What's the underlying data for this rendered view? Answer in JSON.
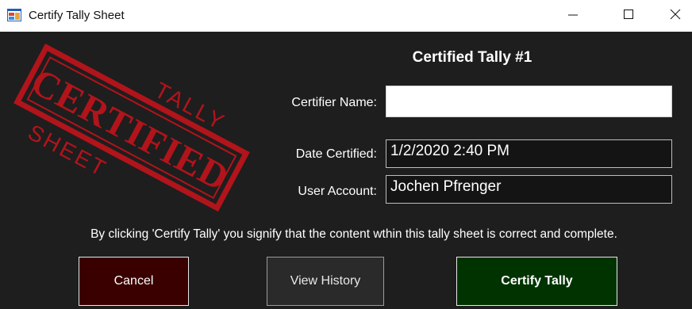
{
  "window": {
    "title": "Certify Tally Sheet",
    "controls": [
      "minimize",
      "maximize",
      "close"
    ]
  },
  "stamp": {
    "top_text": "TALLY",
    "main_text": "CERTIFIED",
    "bottom_text": "SHEET",
    "color": "#b1141b"
  },
  "form": {
    "heading": "Certified Tally #1",
    "certifier_label": "Certifier Name:",
    "certifier_value": "",
    "date_label": "Date Certified:",
    "date_value": "1/2/2020 2:40 PM",
    "user_label": "User Account:",
    "user_value": "Jochen Pfrenger"
  },
  "notice": "By clicking 'Certify Tally' you signify that the content wthin this tally sheet is correct and complete.",
  "buttons": {
    "cancel": "Cancel",
    "view_history": "View History",
    "certify": "Certify Tally"
  },
  "colors": {
    "background": "#1e1e1e",
    "cancel_bg": "#3a0000",
    "certify_bg": "#003300",
    "history_bg": "#2a2a2a"
  }
}
